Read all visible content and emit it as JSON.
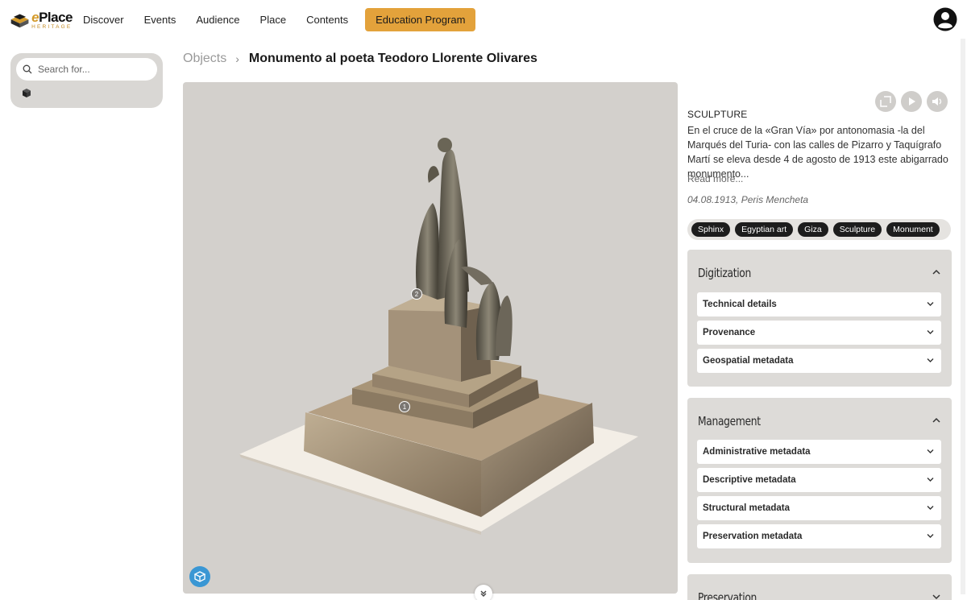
{
  "logo": {
    "line1_e": "e",
    "line1_rest": "Place",
    "line2": "HERITAGE"
  },
  "nav": {
    "items": [
      "Discover",
      "Events",
      "Audience",
      "Place",
      "Contents"
    ],
    "highlight": "Education Program"
  },
  "search": {
    "placeholder": "Search for..."
  },
  "breadcrumb": {
    "parent": "Objects",
    "separator": "›",
    "current": "Monumento al poeta Teodoro Llorente Olivares"
  },
  "viewer": {
    "hotspots": [
      "1",
      "2"
    ]
  },
  "info": {
    "category": "SCULPTURE",
    "description": "En el cruce de la «Gran Vía» por antonomasia -la del Marqués del Turia- con las calles de Pizarro y Taquígrafo Martí se eleva desde 4 de agosto de 1913 este abigarrado monumento...",
    "read_more": "Read more...",
    "meta": "04.08.1913, Peris Mencheta",
    "tags": [
      "Sphinx",
      "Egyptian art",
      "Giza",
      "Sculpture",
      "Monument"
    ]
  },
  "sections": {
    "digitization": {
      "title": "Digitization",
      "items": [
        "Technical details",
        "Provenance",
        "Geospatial metadata"
      ]
    },
    "management": {
      "title": "Management",
      "items": [
        "Administrative metadata",
        "Descriptive metadata",
        "Structural metadata",
        "Preservation metadata"
      ]
    },
    "preservation": {
      "title": "Preservation"
    }
  },
  "colors": {
    "accent": "#e3a23b",
    "ar_button": "#3a97d4",
    "panel": "#dddbd8"
  },
  "icons": [
    "logo-icon",
    "account-icon",
    "search-icon",
    "cube-icon",
    "fullscreen-icon",
    "play-icon",
    "sound-icon",
    "chevron-up-icon",
    "chevron-down-icon",
    "ar-cube-icon",
    "scroll-down-icon"
  ]
}
